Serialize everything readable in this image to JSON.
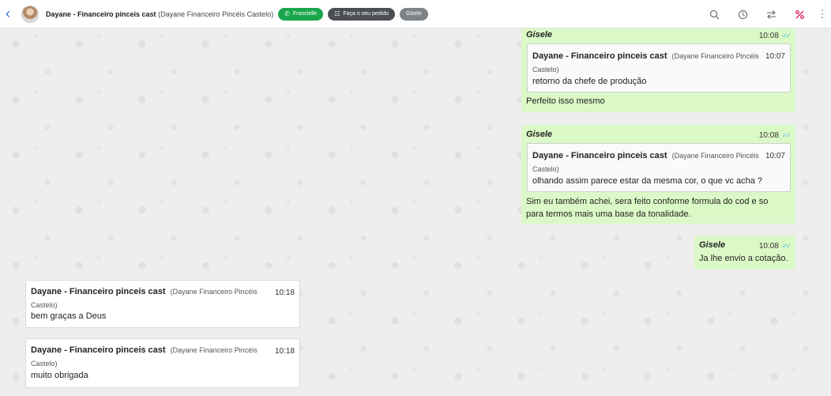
{
  "header": {
    "contact_name": "Dayane - Financeiro pinceis cast",
    "contact_sub": "(Dayane Financeiro Pincéis Castelo)",
    "chips": [
      {
        "label": "Francielle",
        "icon": "whatsapp-icon"
      },
      {
        "label": "Faça o seu pedido",
        "icon": "flow-icon"
      },
      {
        "label": "Gisele"
      }
    ],
    "icons": [
      "search-icon",
      "history-icon",
      "transfer-icon",
      "percent-icon",
      "more-icon"
    ]
  },
  "messages": [
    {
      "direction": "out",
      "sender": "Gisele",
      "time": "10:08",
      "quote": {
        "name": "Dayane - Financeiro pinceis cast",
        "sub_a": "(Dayane Financeiro Pincéis",
        "sub_b": "Castelo)",
        "time": "10:07",
        "text": "retorno da chefe de produção"
      },
      "text": "Perfeito isso mesmo"
    },
    {
      "direction": "out",
      "sender": "Gisele",
      "time": "10:08",
      "quote": {
        "name": "Dayane - Financeiro pinceis cast",
        "sub_a": "(Dayane Financeiro Pincéis",
        "sub_b": "Castelo)",
        "time": "10:07",
        "text": "olhando assim parece estar da mesma cor, o que vc acha ?"
      },
      "text_line1": "Sim eu também achei, sera feito conforme formula do cod e so",
      "text_line2": "para termos mais uma base da tonalidade."
    },
    {
      "direction": "out",
      "sender": "Gisele",
      "time": "10:08",
      "text": "Ja lhe envio a cotação."
    },
    {
      "direction": "in",
      "name": "Dayane - Financeiro pinceis cast",
      "sub_a": "(Dayane Financeiro Pincéis",
      "sub_b": "Castelo)",
      "time": "10:18",
      "text": "bem graças a Deus"
    },
    {
      "direction": "in",
      "name": "Dayane - Financeiro pinceis cast",
      "sub_a": "(Dayane Financeiro Pincéis",
      "sub_b": "Castelo)",
      "time": "10:18",
      "text": "muito obrigada"
    }
  ]
}
